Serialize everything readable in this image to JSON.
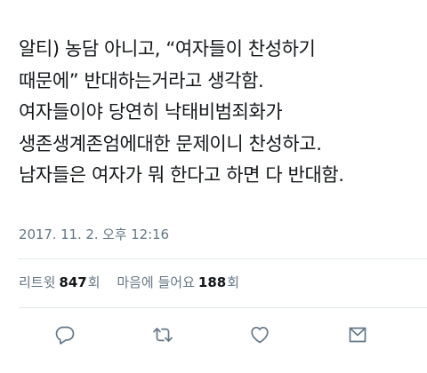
{
  "tweet": {
    "body_lines": [
      "알티) 농담 아니고, “여자들이 찬성하기",
      "때문에” 반대하는거라고 생각함.",
      "여자들이야 당연히 낙태비범죄화가",
      "생존생계존엄에대한 문제이니 찬성하고.",
      "남자들은 여자가 뭐 한다고 하면 다 반대함."
    ],
    "timestamp": "2017. 11. 2. 오후 12:16"
  },
  "stats": {
    "retweets": {
      "label": "리트윗",
      "count": "847",
      "unit": "회"
    },
    "likes": {
      "label": "마음에 들어요",
      "count": "188",
      "unit": "회"
    }
  },
  "actions": [
    {
      "name": "reply",
      "icon": "reply-icon"
    },
    {
      "name": "retweet",
      "icon": "retweet-icon"
    },
    {
      "name": "like",
      "icon": "heart-icon"
    },
    {
      "name": "share",
      "icon": "share-icon"
    }
  ],
  "colors": {
    "text": "#14171a",
    "secondary": "#657786",
    "divider": "#e1e8ed",
    "background": "#ffffff"
  }
}
